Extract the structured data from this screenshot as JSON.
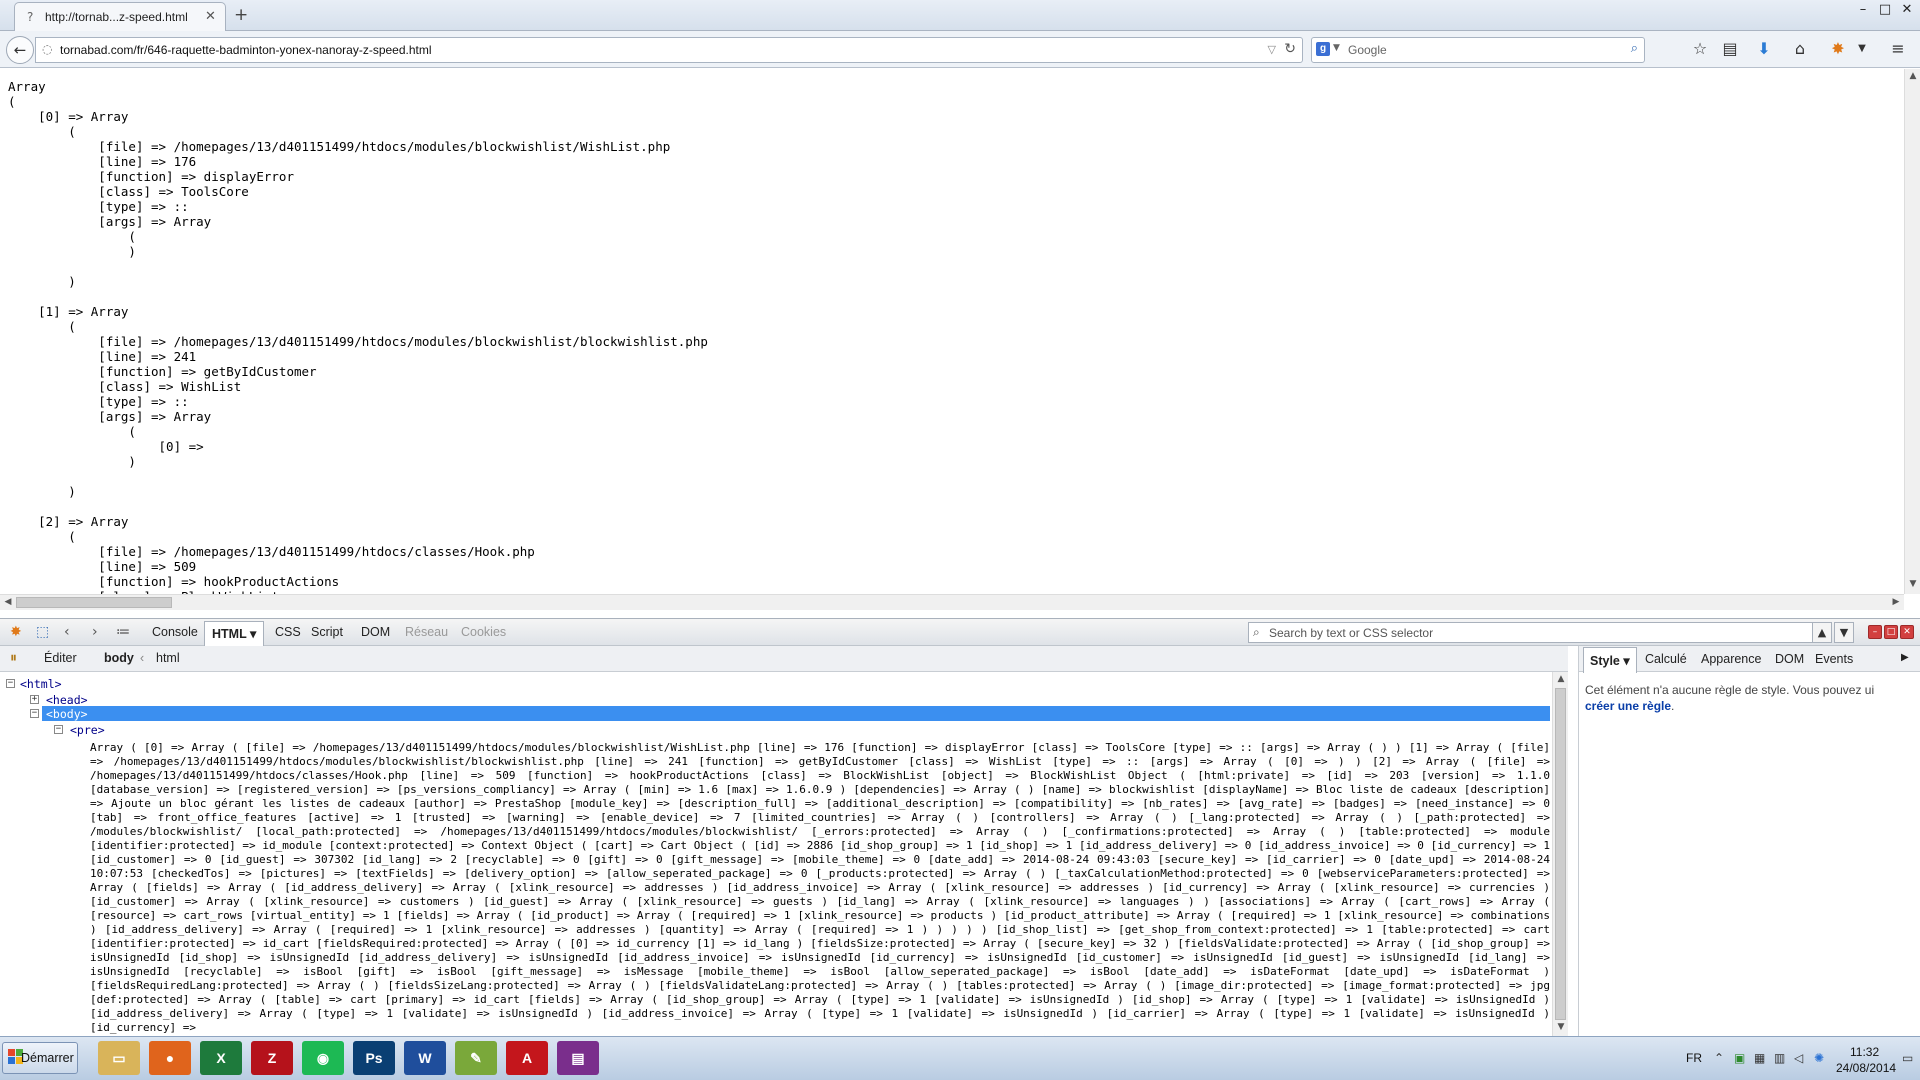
{
  "browser": {
    "tab_title": "http://tornab...z-speed.html",
    "url": "tornabad.com/fr/646-raquette-badminton-yonex-nanoray-z-speed.html",
    "search_placeholder": "Google",
    "window_controls": {
      "minimize": "–",
      "maximize": "□",
      "close": "✕"
    }
  },
  "page": {
    "dump": "Array\n(\n    [0] => Array\n        (\n            [file] => /homepages/13/d401151499/htdocs/modules/blockwishlist/WishList.php\n            [line] => 176\n            [function] => displayError\n            [class] => ToolsCore\n            [type] => ::\n            [args] => Array\n                (\n                )\n\n        )\n\n    [1] => Array\n        (\n            [file] => /homepages/13/d401151499/htdocs/modules/blockwishlist/blockwishlist.php\n            [line] => 241\n            [function] => getByIdCustomer\n            [class] => WishList\n            [type] => ::\n            [args] => Array\n                (\n                    [0] => \n                )\n\n        )\n\n    [2] => Array\n        (\n            [file] => /homepages/13/d401151499/htdocs/classes/Hook.php\n            [line] => 509\n            [function] => hookProductActions\n            [class] => BlockWishList"
  },
  "firebug": {
    "tabs": [
      "Console",
      "HTML",
      "CSS",
      "Script",
      "DOM",
      "Réseau",
      "Cookies"
    ],
    "search_placeholder": "Search by text or CSS selector",
    "edit_label": "Éditer",
    "breadcrumb": [
      "body",
      "html"
    ],
    "nodes": {
      "html": "<html>",
      "head": "<head>",
      "body": "<body>",
      "pre": "<pre>"
    },
    "pre_content": "Array ( [0] => Array ( [file] => /homepages/13/d401151499/htdocs/modules/blockwishlist/WishList.php [line] => 176 [function] => displayError [class] => ToolsCore [type] => :: [args] => Array ( ) ) [1] => Array ( [file] => /homepages/13/d401151499/htdocs/modules/blockwishlist/blockwishlist.php [line] => 241 [function] => getByIdCustomer [class] => WishList [type] => :: [args] => Array ( [0] => ) ) [2] => Array ( [file] => /homepages/13/d401151499/htdocs/classes/Hook.php [line] => 509 [function] => hookProductActions [class] => BlockWishList [object] => BlockWishList Object ( [html:private] => [id] => 203 [version] => 1.1.0 [database_version] => [registered_version] => [ps_versions_compliancy] => Array ( [min] => 1.6 [max] => 1.6.0.9 ) [dependencies] => Array ( ) [name] => blockwishlist [displayName] => Bloc liste de cadeaux [description] => Ajoute un bloc gérant les listes de cadeaux [author] => PrestaShop [module_key] => [description_full] => [additional_description] => [compatibility] => [nb_rates] => [avg_rate] => [badges] => [need_instance] => 0 [tab] => front_office_features [active] => 1 [trusted] => [warning] => [enable_device] => 7 [limited_countries] => Array ( ) [controllers] => Array ( ) [_lang:protected] => Array ( ) [_path:protected] => /modules/blockwishlist/ [local_path:protected] => /homepages/13/d401151499/htdocs/modules/blockwishlist/ [_errors:protected] => Array ( ) [_confirmations:protected] => Array ( ) [table:protected] => module [identifier:protected] => id_module [context:protected] => Context Object ( [cart] => Cart Object ( [id] => 2886 [id_shop_group] => 1 [id_shop] => 1 [id_address_delivery] => 0 [id_address_invoice] => 0 [id_currency] => 1 [id_customer] => 0 [id_guest] => 307302 [id_lang] => 2 [recyclable] => 0 [gift] => 0 [gift_message] => [mobile_theme] => 0 [date_add] => 2014-08-24 09:43:03 [secure_key] => [id_carrier] => 0 [date_upd] => 2014-08-24 10:07:53 [checkedTos] => [pictures] => [textFields] => [delivery_option] => [allow_seperated_package] => 0 [_products:protected] => Array ( ) [_taxCalculationMethod:protected] => 0 [webserviceParameters:protected] => Array ( [fields] => Array ( [id_address_delivery] => Array ( [xlink_resource] => addresses ) [id_address_invoice] => Array ( [xlink_resource] => addresses ) [id_currency] => Array ( [xlink_resource] => currencies ) [id_customer] => Array ( [xlink_resource] => customers ) [id_guest] => Array ( [xlink_resource] => guests ) [id_lang] => Array ( [xlink_resource] => languages ) ) [associations] => Array ( [cart_rows] => Array ( [resource] => cart_rows [virtual_entity] => 1 [fields] => Array ( [id_product] => Array ( [required] => 1 [xlink_resource] => products ) [id_product_attribute] => Array ( [required] => 1 [xlink_resource] => combinations ) [id_address_delivery] => Array ( [required] => 1 [xlink_resource] => addresses ) [quantity] => Array ( [required] => 1 ) ) ) ) ) [id_shop_list] => [get_shop_from_context:protected] => 1 [table:protected] => cart [identifier:protected] => id_cart [fieldsRequired:protected] => Array ( [0] => id_currency [1] => id_lang ) [fieldsSize:protected] => Array ( [secure_key] => 32 ) [fieldsValidate:protected] => Array ( [id_shop_group] => isUnsignedId [id_shop] => isUnsignedId [id_address_delivery] => isUnsignedId [id_address_invoice] => isUnsignedId [id_currency] => isUnsignedId [id_customer] => isUnsignedId [id_guest] => isUnsignedId [id_lang] => isUnsignedId [recyclable] => isBool [gift] => isBool [gift_message] => isMessage [mobile_theme] => isBool [allow_seperated_package] => isBool [date_add] => isDateFormat [date_upd] => isDateFormat ) [fieldsRequiredLang:protected] => Array ( ) [fieldsSizeLang:protected] => Array ( ) [fieldsValidateLang:protected] => Array ( ) [tables:protected] => Array ( ) [image_dir:protected] => [image_format:protected] => jpg [def:protected] => Array ( [table] => cart [primary] => id_cart [fields] => Array ( [id_shop_group] => Array ( [type] => 1 [validate] => isUnsignedId ) [id_shop] => Array ( [type] => 1 [validate] => isUnsignedId ) [id_address_delivery] => Array ( [type] => 1 [validate] => isUnsignedId ) [id_address_invoice] => Array ( [type] => 1 [validate] => isUnsignedId ) [id_carrier] => Array ( [type] => 1 [validate] => isUnsignedId ) [id_currency] =>",
    "side_tabs": [
      "Style",
      "Calculé",
      "Apparence",
      "DOM",
      "Events"
    ],
    "side_message": "Cet élément n'a aucune règle de style. Vous pouvez ui",
    "side_link": "créer une règle",
    "side_period": "."
  },
  "taskbar": {
    "start_label": "Démarrer",
    "apps": [
      {
        "name": "explorer",
        "glyph": "▭",
        "color": "#d9b45a"
      },
      {
        "name": "firefox",
        "glyph": "●",
        "color": "#e0641c"
      },
      {
        "name": "excel",
        "glyph": "X",
        "color": "#1e7a3c"
      },
      {
        "name": "filezilla",
        "glyph": "Z",
        "color": "#b5121b"
      },
      {
        "name": "spotify",
        "glyph": "◉",
        "color": "#1db954"
      },
      {
        "name": "photoshop",
        "glyph": "Ps",
        "color": "#0a3f73"
      },
      {
        "name": "word",
        "glyph": "W",
        "color": "#1f4e9c"
      },
      {
        "name": "notepad",
        "glyph": "✎",
        "color": "#7aa83a"
      },
      {
        "name": "acrobat",
        "glyph": "A",
        "color": "#c4161c"
      },
      {
        "name": "winrar",
        "glyph": "▤",
        "color": "#7a2e8c"
      }
    ],
    "language": "FR",
    "time": "11:32",
    "date": "24/08/2014"
  }
}
